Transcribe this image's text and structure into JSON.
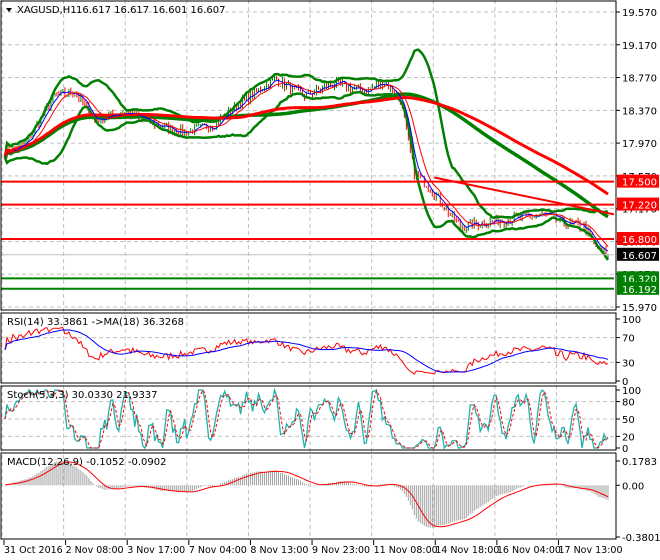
{
  "chart_data": {
    "type": "line",
    "title": "XAGUSD,H1",
    "ohlc_readout": "16.617 16.617 16.601 16.607",
    "symbol_menu_icon": "triangle-down-icon",
    "price_axis": {
      "ticks": [
        "19.570",
        "19.170",
        "18.770",
        "18.370",
        "17.970",
        "17.570",
        "17.170",
        "16.770",
        "16.370",
        "15.970"
      ],
      "ylim": [
        15.97,
        19.57
      ]
    },
    "time_labels": [
      "31 Oct 2016",
      "2 Nov 08:00",
      "3 Nov 17:00",
      "7 Nov 04:00",
      "8 Nov 13:00",
      "9 Nov 23:00",
      "11 Nov 08:00",
      "14 Nov 18:00",
      "16 Nov 04:00",
      "17 Nov 13:00"
    ],
    "close_anchors": [
      [
        0,
        17.85
      ],
      [
        10,
        17.95
      ],
      [
        25,
        18.55
      ],
      [
        35,
        18.6
      ],
      [
        45,
        18.25
      ],
      [
        60,
        18.35
      ],
      [
        75,
        18.2
      ],
      [
        90,
        18.1
      ],
      [
        105,
        18.2
      ],
      [
        120,
        18.5
      ],
      [
        135,
        18.75
      ],
      [
        150,
        18.55
      ],
      [
        165,
        18.7
      ],
      [
        180,
        18.6
      ],
      [
        190,
        18.72
      ],
      [
        198,
        18.5
      ],
      [
        205,
        17.6
      ],
      [
        212,
        17.45
      ],
      [
        220,
        17.2
      ],
      [
        228,
        16.95
      ],
      [
        240,
        17.0
      ],
      [
        255,
        17.05
      ],
      [
        270,
        17.1
      ],
      [
        280,
        17.0
      ],
      [
        290,
        16.95
      ],
      [
        296,
        16.7
      ],
      [
        302,
        16.607
      ]
    ],
    "horizontal_levels": [
      {
        "value": 17.5,
        "label": "17.500",
        "color": "#ff0000"
      },
      {
        "value": 17.22,
        "label": "17.220",
        "color": "#ff0000"
      },
      {
        "value": 16.8,
        "label": "16.800",
        "color": "#ff0000"
      },
      {
        "value": 16.32,
        "label": "16.320",
        "color": "#008000"
      },
      {
        "value": 16.192,
        "label": "16.192",
        "color": "#008000"
      }
    ],
    "current_price": {
      "value": 16.607,
      "label": "16.607"
    },
    "trendline": {
      "from": [
        215,
        17.55
      ],
      "to": [
        302,
        17.1
      ],
      "color": "#ff0000"
    },
    "indicators": {
      "rsi": {
        "label": "RSI(14) 33.3861  ->MA(18) 36.3268",
        "ticks": [
          "100",
          "70",
          "30",
          "0"
        ],
        "ylim": [
          0,
          100
        ]
      },
      "stoch": {
        "label": "Stoch(5,3,3) 30.0330 21.9337",
        "ticks": [
          "100",
          "80",
          "50",
          "20",
          "0"
        ],
        "ylim": [
          0,
          100
        ]
      },
      "macd": {
        "label": "MACD(12,26,9) -0.1052 -0.0902",
        "ticks": [
          "0.1783",
          "0.00",
          "-0.3801"
        ],
        "ylim": [
          -0.3801,
          0.1783
        ]
      }
    },
    "colors": {
      "bull": "#008000",
      "bear": "#ff0000",
      "band": "#008000",
      "ma_slow": "#ff0000",
      "ma_fast": "#0000ff",
      "stoch_main": "#20b2aa"
    }
  }
}
